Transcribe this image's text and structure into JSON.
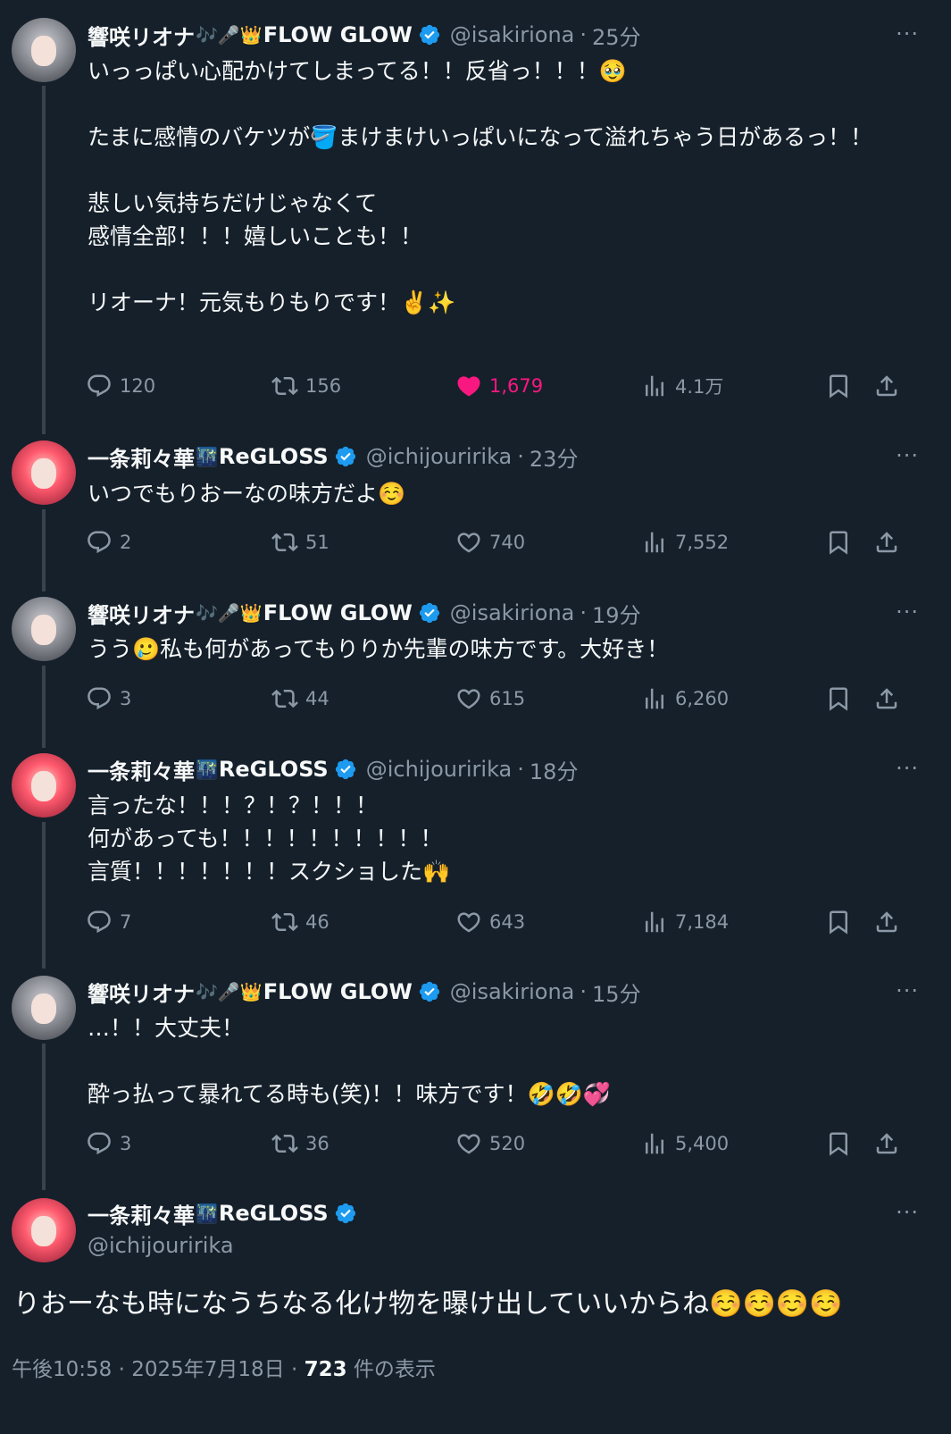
{
  "users": {
    "riona": {
      "name": "響咲リオナ",
      "badges": "🎶🎤👑",
      "group": "FLOW GLOW",
      "handle": "@isakiriona"
    },
    "ririka": {
      "name": "一条莉々華",
      "badges": "🌃",
      "group": "ReGLOSS",
      "handle": "@ichijouririka"
    }
  },
  "tweets": [
    {
      "author": "riona",
      "time": "25分",
      "text": "いっっぱい心配かけてしまってる！！反省っ！！！🥹\n\nたまに感情のバケツが🪣まけまけいっぱいになって溢れちゃう日があるっ！！\n\n悲しい気持ちだけじゃなくて\n感情全部！！！嬉しいことも！！\n\nリオーナ！元気もりもりです！✌️✨",
      "replies": "120",
      "reposts": "156",
      "likes": "1,679",
      "views": "4.1万",
      "liked": true
    },
    {
      "author": "ririka",
      "time": "23分",
      "text": "いつでもりおーなの味方だよ☺️",
      "replies": "2",
      "reposts": "51",
      "likes": "740",
      "views": "7,552",
      "liked": false
    },
    {
      "author": "riona",
      "time": "19分",
      "text": "うう🥲私も何があってもりりか先輩の味方です。大好き！",
      "replies": "3",
      "reposts": "44",
      "likes": "615",
      "views": "6,260",
      "liked": false
    },
    {
      "author": "ririka",
      "time": "18分",
      "text": "言ったな！！！？！？！！！\n何があっても！！！！！！！！！！\n言質！！！！！！！スクショした🙌",
      "replies": "7",
      "reposts": "46",
      "likes": "643",
      "views": "7,184",
      "liked": false
    },
    {
      "author": "riona",
      "time": "15分",
      "text": "…！！大丈夫！\n\n酔っ払って暴れてる時も(笑)！！味方です！🤣🤣💞",
      "replies": "3",
      "reposts": "36",
      "likes": "520",
      "views": "5,400",
      "liked": false
    }
  ],
  "main_tweet": {
    "author": "ririka",
    "text": "りおーなも時になうちなる化け物を曝け出していいからね☺️☺️☺️☺️",
    "time": "午後10:58 · 2025年7月18日 · ",
    "views_count": "723",
    "views_label": " 件の表示"
  },
  "more_label": "···",
  "colors": {
    "background": "#15202b",
    "like": "#f91880",
    "verified": "#1d9bf0",
    "muted": "#8b98a5"
  }
}
